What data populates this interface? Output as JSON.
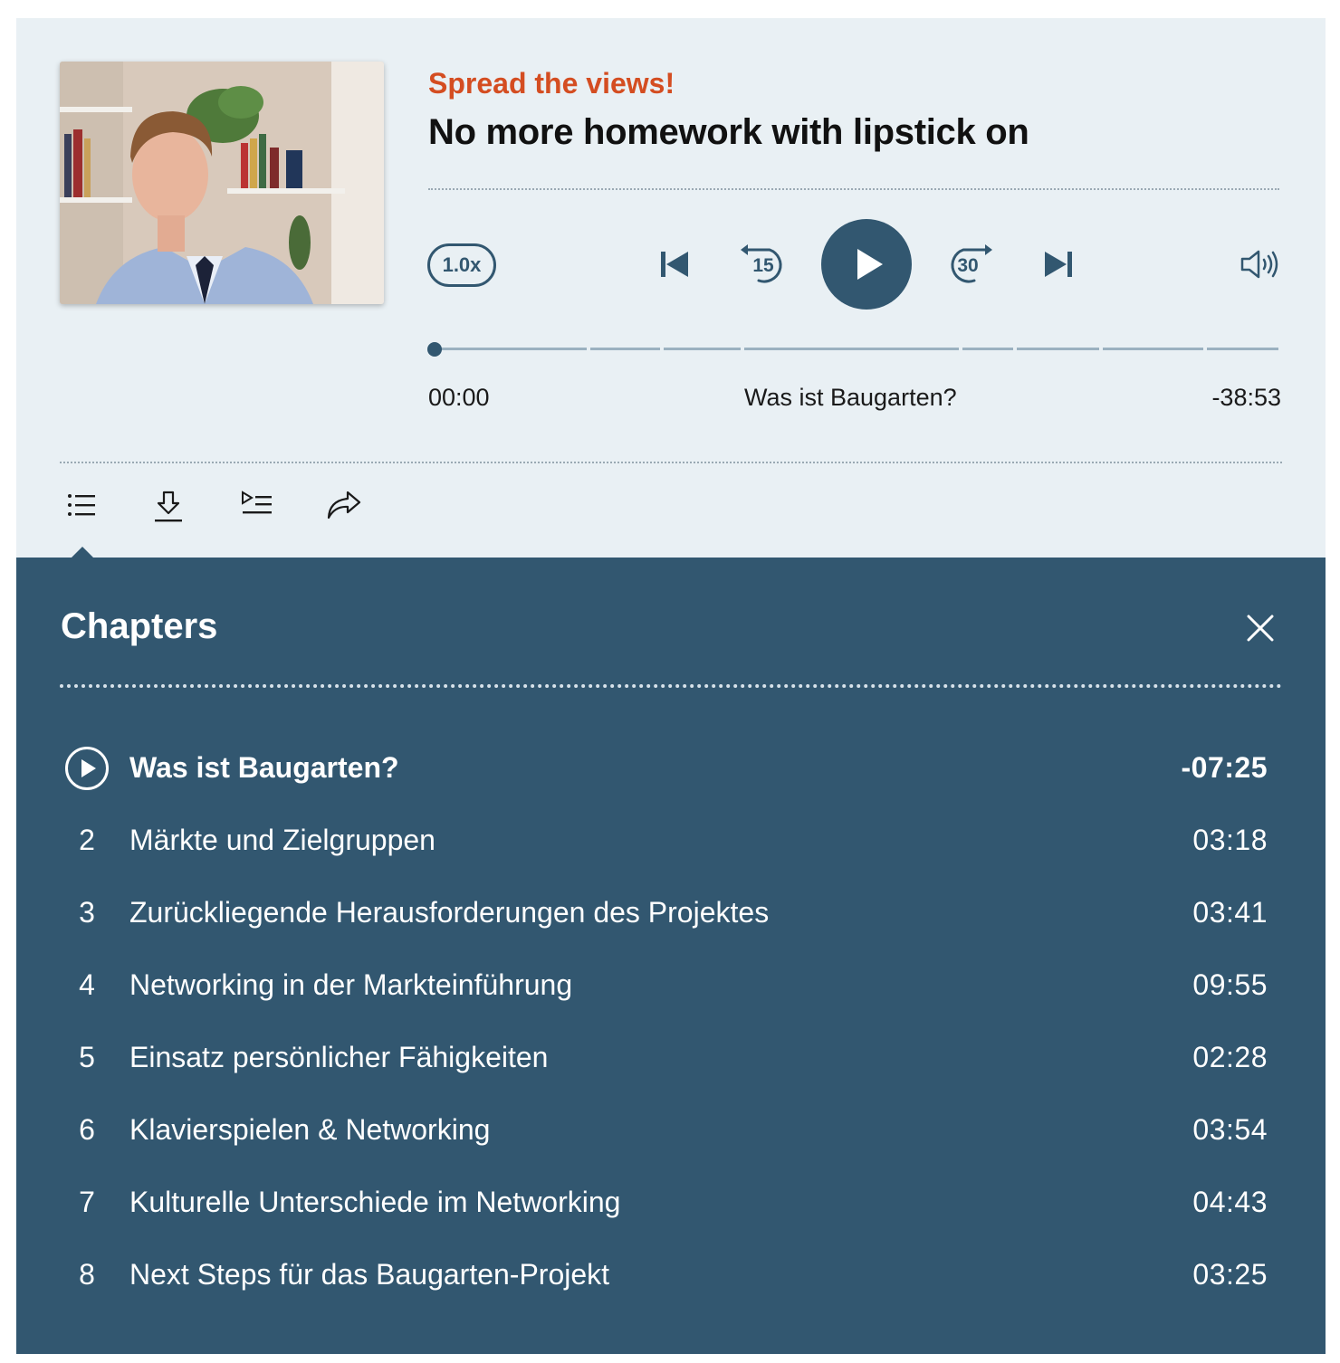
{
  "episode": {
    "subtitle": "Spread the views!",
    "title": "No more homework with lipstick on",
    "cover_alt": "Episode cover photo"
  },
  "controls": {
    "speed": "1.0x",
    "rewind_seconds": "15",
    "forward_seconds": "30",
    "icons": [
      "skip-back-icon",
      "rewind-15-icon",
      "play-icon",
      "forward-30-icon",
      "skip-forward-icon",
      "volume-icon"
    ]
  },
  "progress": {
    "elapsed": "00:00",
    "current_chapter": "Was ist Baugarten?",
    "remaining": "-38:53",
    "fraction": 0
  },
  "toolbar": {
    "icons": [
      "chapters-list-icon",
      "download-icon",
      "playlist-icon",
      "share-icon"
    ]
  },
  "chapters_panel": {
    "title": "Chapters",
    "items": [
      {
        "num": "1",
        "name": "Was ist Baugarten?",
        "duration": "-07:25",
        "active": true
      },
      {
        "num": "2",
        "name": "Märkte und Zielgruppen",
        "duration": "03:18"
      },
      {
        "num": "3",
        "name": "Zurückliegende Herausforderungen des Projektes",
        "duration": "03:41"
      },
      {
        "num": "4",
        "name": "Networking in der Markteinführung",
        "duration": "09:55"
      },
      {
        "num": "5",
        "name": "Einsatz persönlicher Fähigkeiten",
        "duration": "02:28"
      },
      {
        "num": "6",
        "name": "Klavierspielen & Networking",
        "duration": "03:54"
      },
      {
        "num": "7",
        "name": "Kulturelle Unterschiede im Networking",
        "duration": "04:43"
      },
      {
        "num": "8",
        "name": "Next Steps für das Baugarten-Projekt",
        "duration": "03:25"
      }
    ]
  },
  "colors": {
    "accent": "#325770",
    "subtitle": "#d44d21",
    "background": "#e9f0f4"
  }
}
